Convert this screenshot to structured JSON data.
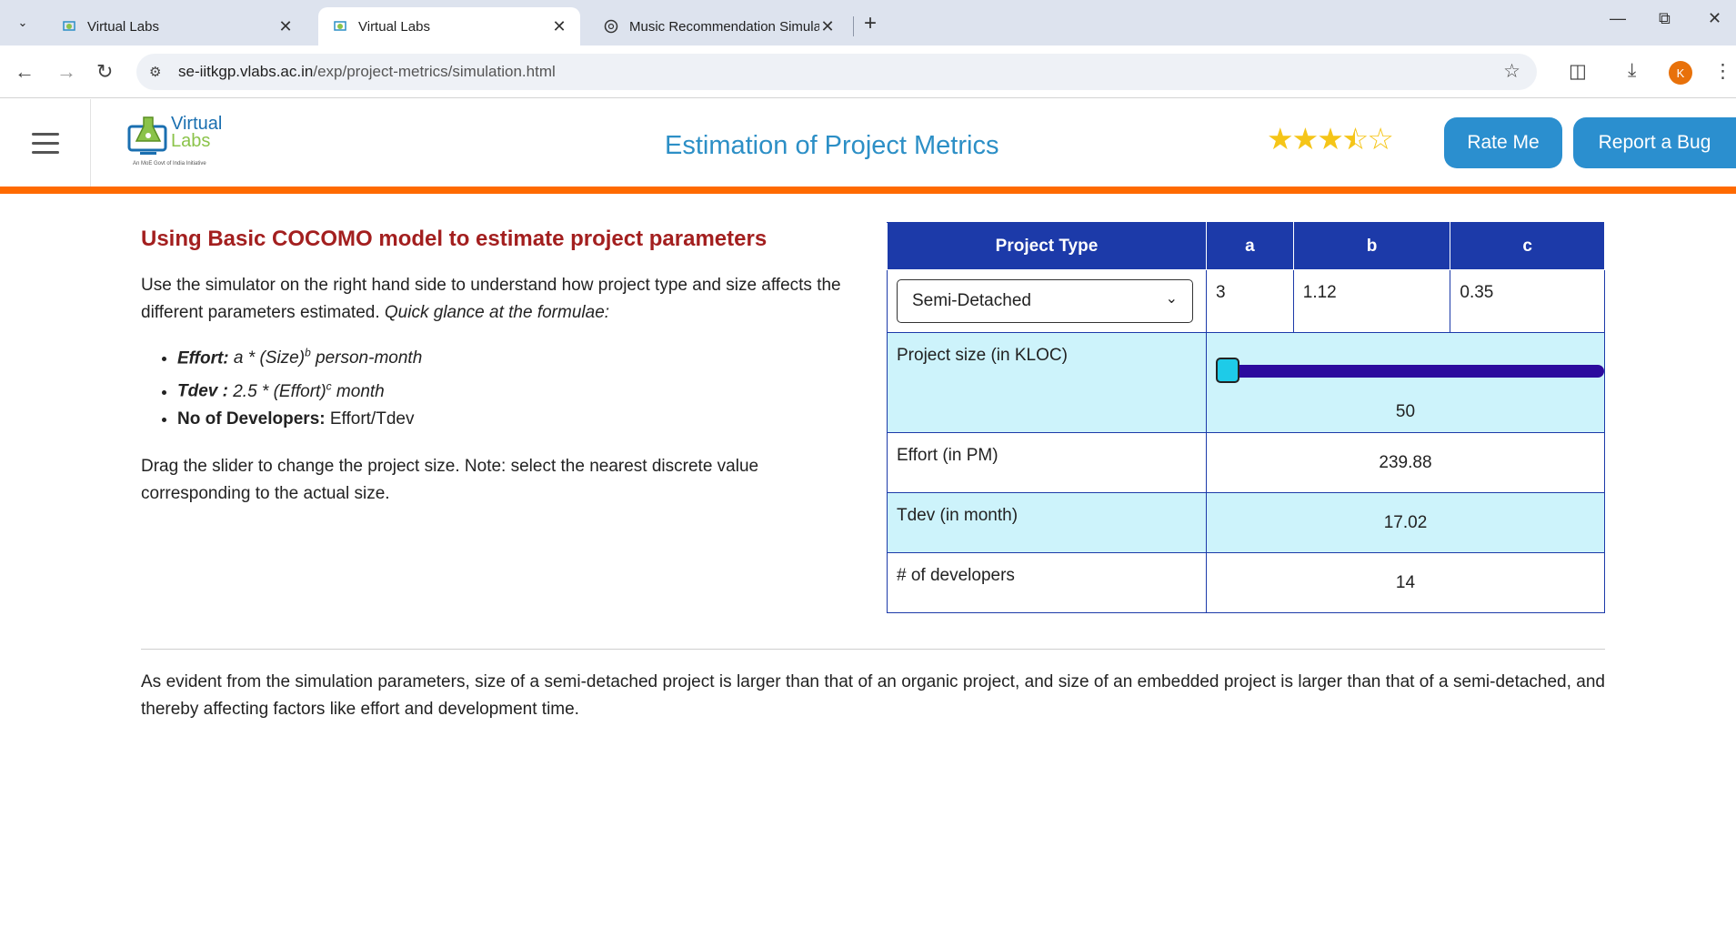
{
  "browser": {
    "tabs": [
      {
        "title": "Virtual Labs",
        "active": false
      },
      {
        "title": "Virtual Labs",
        "active": true
      },
      {
        "title": "Music Recommendation Simula",
        "active": false
      }
    ],
    "url_host": "se-iitkgp.vlabs.ac.in",
    "url_path": "/exp/project-metrics/simulation.html",
    "avatar_letter": "K"
  },
  "header": {
    "logo_line1": "Virtual",
    "logo_line2": "Labs",
    "logo_tagline": "An MoE Govt of India Initiative",
    "title": "Estimation of Project Metrics",
    "rating": 3.5,
    "rate_button": "Rate Me",
    "bug_button": "Report a Bug",
    "accent_color": "#ff6a00"
  },
  "left": {
    "heading": "Using Basic COCOMO model to estimate project parameters",
    "intro": "Use the simulator on the right hand side to understand how project type and size affects the different parameters estimated.",
    "intro_italic": "Quick glance at the formulae:",
    "formulae": {
      "effort_label": "Effort:",
      "effort_a": "a * (Size)",
      "effort_sup": "b",
      "effort_unit": " person-month",
      "tdev_label": "Tdev :",
      "tdev_a": "2.5 * (Effort)",
      "tdev_sup": "c",
      "tdev_unit": " month",
      "dev_label": "No of Developers:",
      "dev_value": "Effort/Tdev"
    },
    "note": "Drag the slider to change the project size. Note: select the nearest discrete value corresponding to the actual size."
  },
  "simulator": {
    "headers": {
      "type": "Project Type",
      "a": "a",
      "b": "b",
      "c": "c"
    },
    "selected_type": "Semi-Detached",
    "a": "3",
    "b": "1.12",
    "c": "0.35",
    "size_label": "Project size (in KLOC)",
    "size_value": "50",
    "size_slider_fraction": 0.0,
    "effort_label": "Effort (in PM)",
    "effort_value": "239.88",
    "tdev_label": "Tdev (in month)",
    "tdev_value": "17.02",
    "devs_label": "# of developers",
    "devs_value": "14"
  },
  "conclusion": "As evident from the simulation parameters, size of a semi-detached project is larger than that of an organic project, and size of an embedded project is larger than that of a semi-detached, and thereby affecting factors like effort and development time."
}
